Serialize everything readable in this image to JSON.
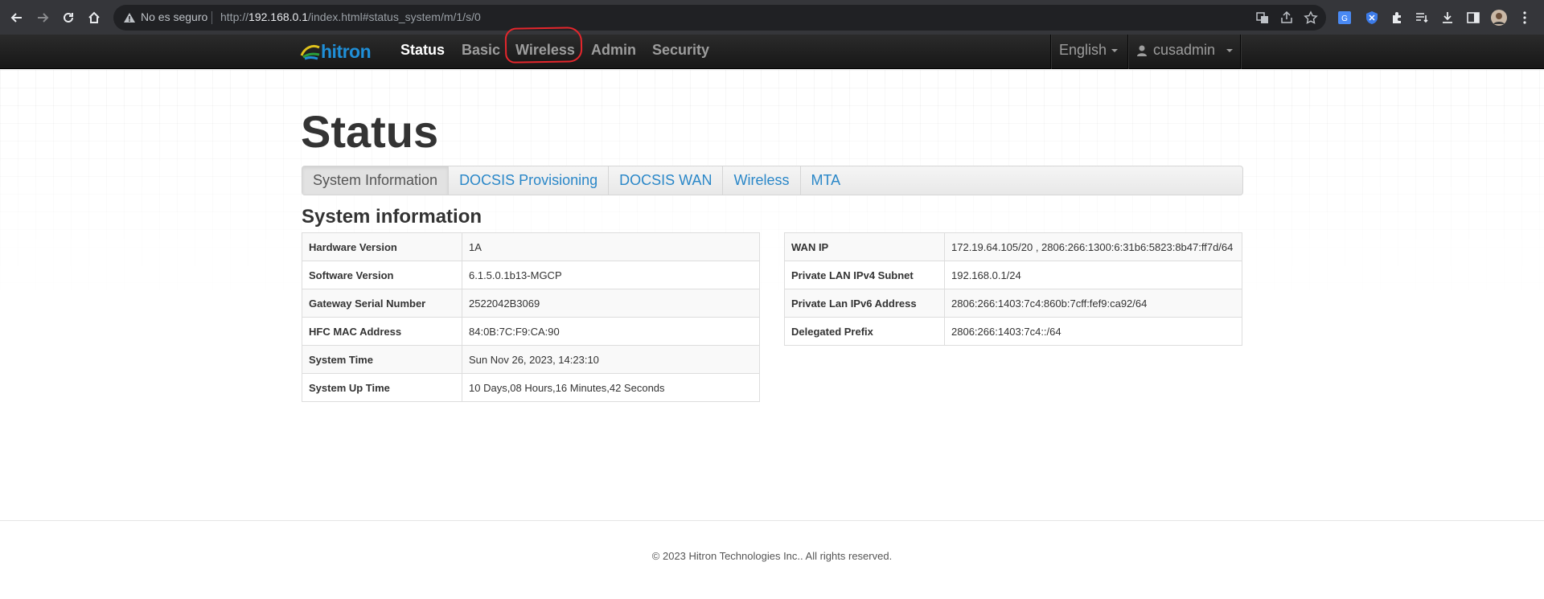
{
  "browser": {
    "security_label": "No es seguro",
    "url_prefix": "http://",
    "url_host": "192.168.0.1",
    "url_path": "/index.html#status_system/m/1/s/0"
  },
  "navbar": {
    "logo": "hitron",
    "items": [
      "Status",
      "Basic",
      "Wireless",
      "Admin",
      "Security"
    ],
    "active": "Status",
    "language": "English",
    "user": "cusadmin"
  },
  "page": {
    "title": "Status",
    "tabs": [
      "System Information",
      "DOCSIS Provisioning",
      "DOCSIS WAN",
      "Wireless",
      "MTA"
    ],
    "active_tab": "System Information",
    "section_title": "System information"
  },
  "system_info_left": [
    {
      "label": "Hardware Version",
      "value": "1A"
    },
    {
      "label": "Software Version",
      "value": "6.1.5.0.1b13-MGCP"
    },
    {
      "label": "Gateway Serial Number",
      "value": "2522042B3069"
    },
    {
      "label": "HFC MAC Address",
      "value": "84:0B:7C:F9:CA:90"
    },
    {
      "label": "System Time",
      "value": "Sun Nov 26, 2023, 14:23:10"
    },
    {
      "label": "System Up Time",
      "value": "10 Days,08 Hours,16 Minutes,42 Seconds"
    }
  ],
  "system_info_right": [
    {
      "label": "WAN IP",
      "value": "172.19.64.105/20 , 2806:266:1300:6:31b6:5823:8b47:ff7d/64"
    },
    {
      "label": "Private LAN IPv4 Subnet",
      "value": "192.168.0.1/24"
    },
    {
      "label": "Private Lan IPv6 Address",
      "value": "2806:266:1403:7c4:860b:7cff:fef9:ca92/64"
    },
    {
      "label": "Delegated Prefix",
      "value": "2806:266:1403:7c4::/64"
    }
  ],
  "footer": "© 2023 Hitron Technologies Inc.. All rights reserved.",
  "colors": {
    "navbar_bg": "#222222",
    "link": "#2a87c8",
    "annotation_ring": "#e5262c"
  }
}
